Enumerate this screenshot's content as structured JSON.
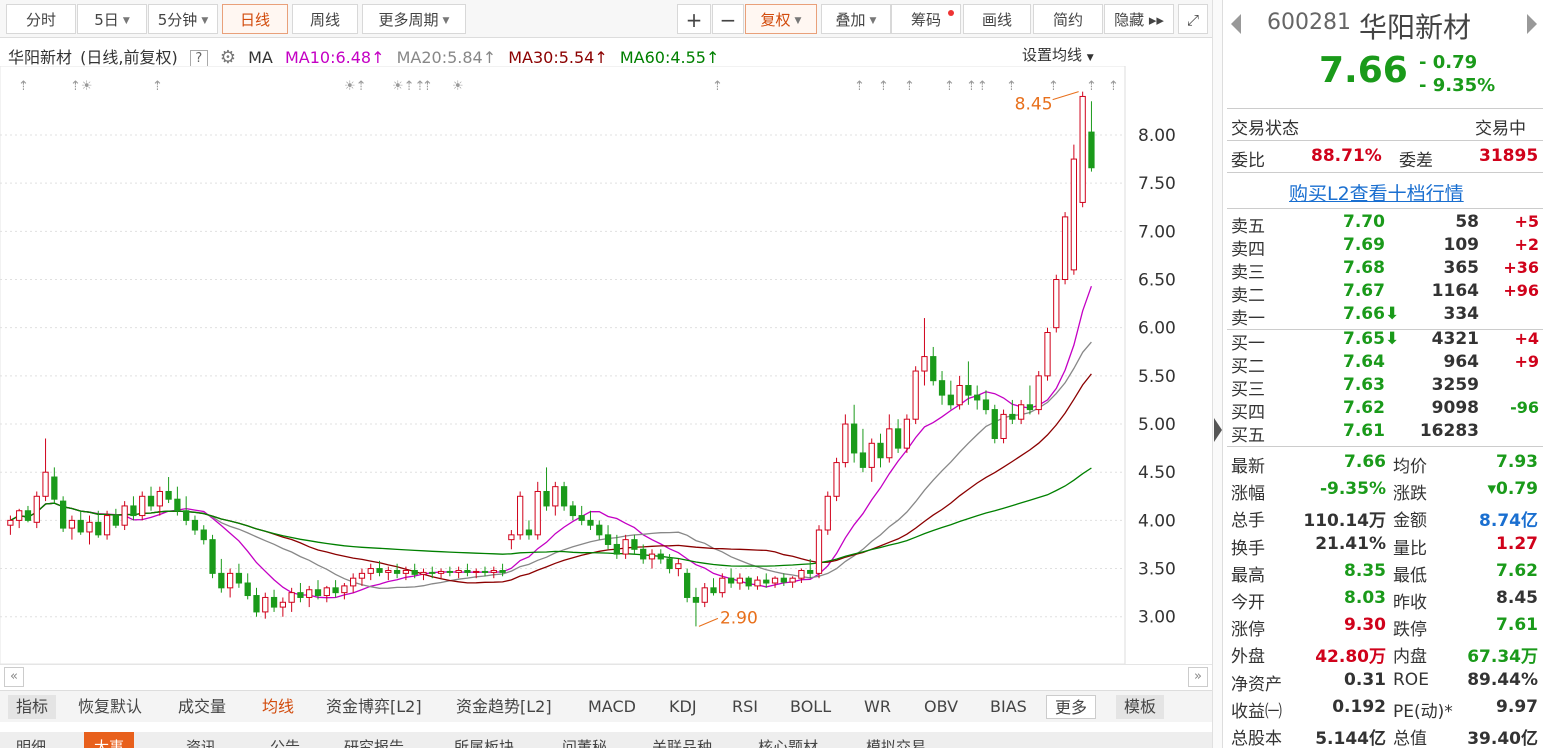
{
  "toolbar": {
    "items": [
      "分时",
      "5日",
      "5分钟",
      "日线",
      "周线",
      "更多周期",
      "+",
      "−",
      "复权",
      "叠加",
      "筹码",
      "画线",
      "简约",
      "隐藏 ▸▸"
    ],
    "active": "日线",
    "fullscreen_icon": "expand-icon"
  },
  "ma_bar": {
    "stock": "华阳新材",
    "mode": "(日线,前复权)",
    "help": "?",
    "ma_label": "MA",
    "ma10": "MA10:6.48",
    "ma20": "MA20:5.84",
    "ma30": "MA30:5.54",
    "ma60": "MA60:4.55",
    "up_arrow": "↑",
    "settings": "设置均线",
    "colors": {
      "ma10": "#c400c4",
      "ma20": "#888888",
      "ma30": "#8b0000",
      "ma60": "#008000"
    }
  },
  "chart_data": {
    "type": "candlestick",
    "y_ticks": [
      "8.00",
      "7.50",
      "7.00",
      "6.50",
      "6.00",
      "5.50",
      "5.00",
      "4.50",
      "4.00",
      "3.50",
      "3.00"
    ],
    "ylim": [
      2.8,
      8.55
    ],
    "high_label": "8.45",
    "low_label": "2.90",
    "candles": [
      [
        3.95,
        4.05,
        3.85,
        4.0
      ],
      [
        4.0,
        4.12,
        3.92,
        4.1
      ],
      [
        4.1,
        4.15,
        3.98,
        4.0
      ],
      [
        3.98,
        4.3,
        3.92,
        4.25
      ],
      [
        4.25,
        4.85,
        4.2,
        4.5
      ],
      [
        4.45,
        4.55,
        4.18,
        4.22
      ],
      [
        4.2,
        4.25,
        3.88,
        3.92
      ],
      [
        3.92,
        4.05,
        3.8,
        4.0
      ],
      [
        4.0,
        4.1,
        3.85,
        3.88
      ],
      [
        3.88,
        4.05,
        3.75,
        3.98
      ],
      [
        3.98,
        4.1,
        3.82,
        3.85
      ],
      [
        3.85,
        4.1,
        3.8,
        4.05
      ],
      [
        4.05,
        4.12,
        3.92,
        3.95
      ],
      [
        3.95,
        4.2,
        3.9,
        4.15
      ],
      [
        4.15,
        4.25,
        4.0,
        4.05
      ],
      [
        4.05,
        4.3,
        4.0,
        4.25
      ],
      [
        4.25,
        4.35,
        4.1,
        4.15
      ],
      [
        4.15,
        4.35,
        4.05,
        4.3
      ],
      [
        4.3,
        4.45,
        4.18,
        4.22
      ],
      [
        4.22,
        4.35,
        4.05,
        4.1
      ],
      [
        4.1,
        4.25,
        3.95,
        4.0
      ],
      [
        4.0,
        4.05,
        3.85,
        3.9
      ],
      [
        3.9,
        3.95,
        3.75,
        3.8
      ],
      [
        3.8,
        3.85,
        3.4,
        3.45
      ],
      [
        3.45,
        3.6,
        3.25,
        3.3
      ],
      [
        3.3,
        3.5,
        3.2,
        3.45
      ],
      [
        3.45,
        3.55,
        3.3,
        3.35
      ],
      [
        3.35,
        3.45,
        3.18,
        3.22
      ],
      [
        3.22,
        3.3,
        3.0,
        3.05
      ],
      [
        3.05,
        3.25,
        2.98,
        3.2
      ],
      [
        3.2,
        3.28,
        3.05,
        3.1
      ],
      [
        3.1,
        3.2,
        3.0,
        3.15
      ],
      [
        3.15,
        3.3,
        3.05,
        3.25
      ],
      [
        3.25,
        3.35,
        3.15,
        3.2
      ],
      [
        3.2,
        3.32,
        3.1,
        3.28
      ],
      [
        3.28,
        3.38,
        3.18,
        3.22
      ],
      [
        3.22,
        3.32,
        3.15,
        3.3
      ],
      [
        3.3,
        3.38,
        3.2,
        3.25
      ],
      [
        3.25,
        3.35,
        3.18,
        3.32
      ],
      [
        3.32,
        3.45,
        3.25,
        3.4
      ],
      [
        3.4,
        3.5,
        3.32,
        3.45
      ],
      [
        3.45,
        3.55,
        3.38,
        3.5
      ],
      [
        3.5,
        3.58,
        3.42,
        3.46
      ],
      [
        3.46,
        3.52,
        3.38,
        3.48
      ],
      [
        3.48,
        3.55,
        3.4,
        3.45
      ],
      [
        3.45,
        3.52,
        3.38,
        3.48
      ],
      [
        3.48,
        3.55,
        3.4,
        3.44
      ],
      [
        3.44,
        3.5,
        3.38,
        3.46
      ],
      [
        3.46,
        3.52,
        3.4,
        3.45
      ],
      [
        3.45,
        3.5,
        3.4,
        3.47
      ],
      [
        3.47,
        3.52,
        3.42,
        3.46
      ],
      [
        3.46,
        3.52,
        3.4,
        3.48
      ],
      [
        3.48,
        3.55,
        3.42,
        3.46
      ],
      [
        3.46,
        3.5,
        3.4,
        3.47
      ],
      [
        3.47,
        3.52,
        3.42,
        3.46
      ],
      [
        3.46,
        3.52,
        3.4,
        3.48
      ],
      [
        3.48,
        3.55,
        3.42,
        3.46
      ],
      [
        3.8,
        3.9,
        3.7,
        3.85
      ],
      [
        3.85,
        4.3,
        3.8,
        4.25
      ],
      [
        3.9,
        4.0,
        3.8,
        3.85
      ],
      [
        3.85,
        4.4,
        3.8,
        4.3
      ],
      [
        4.3,
        4.55,
        4.1,
        4.15
      ],
      [
        4.15,
        4.4,
        4.05,
        4.35
      ],
      [
        4.35,
        4.4,
        4.1,
        4.15
      ],
      [
        4.15,
        4.2,
        4.0,
        4.05
      ],
      [
        4.05,
        4.15,
        3.95,
        4.0
      ],
      [
        4.0,
        4.1,
        3.9,
        3.95
      ],
      [
        3.95,
        4.0,
        3.8,
        3.85
      ],
      [
        3.85,
        3.95,
        3.7,
        3.75
      ],
      [
        3.75,
        3.85,
        3.6,
        3.65
      ],
      [
        3.65,
        3.85,
        3.6,
        3.8
      ],
      [
        3.8,
        3.85,
        3.65,
        3.7
      ],
      [
        3.7,
        3.75,
        3.55,
        3.6
      ],
      [
        3.6,
        3.7,
        3.5,
        3.65
      ],
      [
        3.65,
        3.7,
        3.55,
        3.6
      ],
      [
        3.6,
        3.65,
        3.45,
        3.5
      ],
      [
        3.5,
        3.6,
        3.42,
        3.55
      ],
      [
        3.45,
        3.5,
        3.15,
        3.2
      ],
      [
        3.2,
        3.3,
        2.9,
        3.15
      ],
      [
        3.15,
        3.35,
        3.1,
        3.3
      ],
      [
        3.3,
        3.4,
        3.22,
        3.25
      ],
      [
        3.25,
        3.45,
        3.2,
        3.4
      ],
      [
        3.4,
        3.5,
        3.3,
        3.35
      ],
      [
        3.35,
        3.45,
        3.28,
        3.4
      ],
      [
        3.4,
        3.42,
        3.28,
        3.32
      ],
      [
        3.32,
        3.42,
        3.28,
        3.38
      ],
      [
        3.38,
        3.45,
        3.3,
        3.35
      ],
      [
        3.35,
        3.42,
        3.3,
        3.4
      ],
      [
        3.4,
        3.45,
        3.32,
        3.36
      ],
      [
        3.36,
        3.42,
        3.3,
        3.4
      ],
      [
        3.4,
        3.5,
        3.35,
        3.48
      ],
      [
        3.48,
        3.6,
        3.4,
        3.45
      ],
      [
        3.45,
        3.95,
        3.4,
        3.9
      ],
      [
        3.9,
        4.3,
        3.85,
        4.25
      ],
      [
        4.25,
        4.65,
        4.2,
        4.6
      ],
      [
        4.6,
        5.1,
        4.55,
        5.0
      ],
      [
        5.0,
        5.2,
        4.6,
        4.7
      ],
      [
        4.7,
        4.95,
        4.5,
        4.55
      ],
      [
        4.55,
        4.85,
        4.4,
        4.8
      ],
      [
        4.8,
        4.9,
        4.55,
        4.65
      ],
      [
        4.65,
        5.1,
        4.6,
        4.95
      ],
      [
        4.95,
        5.05,
        4.7,
        4.75
      ],
      [
        4.75,
        5.1,
        4.7,
        5.05
      ],
      [
        5.05,
        5.6,
        5.0,
        5.55
      ],
      [
        5.55,
        6.1,
        5.4,
        5.7
      ],
      [
        5.7,
        5.8,
        5.4,
        5.45
      ],
      [
        5.45,
        5.55,
        5.2,
        5.3
      ],
      [
        5.3,
        5.45,
        5.15,
        5.2
      ],
      [
        5.2,
        5.5,
        5.15,
        5.4
      ],
      [
        5.4,
        5.65,
        5.2,
        5.3
      ],
      [
        5.3,
        5.4,
        5.15,
        5.25
      ],
      [
        5.25,
        5.35,
        5.1,
        5.15
      ],
      [
        5.15,
        5.2,
        4.8,
        4.85
      ],
      [
        4.85,
        5.15,
        4.8,
        5.1
      ],
      [
        5.1,
        5.25,
        5.0,
        5.05
      ],
      [
        5.05,
        5.25,
        5.0,
        5.2
      ],
      [
        5.2,
        5.4,
        5.1,
        5.15
      ],
      [
        5.15,
        5.55,
        5.1,
        5.5
      ],
      [
        5.5,
        6.0,
        5.45,
        5.95
      ],
      [
        6.0,
        6.55,
        5.95,
        6.5
      ],
      [
        6.5,
        7.2,
        6.45,
        7.15
      ],
      [
        6.6,
        7.9,
        6.55,
        7.75
      ],
      [
        7.3,
        8.45,
        7.25,
        8.4
      ],
      [
        8.03,
        8.35,
        7.62,
        7.66
      ]
    ],
    "ma_series": [
      {
        "name": "MA10",
        "color": "#c400c4"
      },
      {
        "name": "MA20",
        "color": "#888888"
      },
      {
        "name": "MA30",
        "color": "#8b0000"
      },
      {
        "name": "MA60",
        "color": "#008000"
      }
    ],
    "event_markers": [
      "⇡",
      "⇡☀",
      "⇡",
      "☀⇡",
      "☀⇡⇡",
      "⇡",
      "☀",
      "⇡",
      "⇡",
      "⇡",
      "⇡",
      "⇡",
      "⇡⇡",
      "⇡",
      "⇡",
      "⇡",
      "⇡"
    ]
  },
  "bottom_tabs": [
    "指标",
    "恢复默认",
    "成交量",
    "均线",
    "资金博弈[L2]",
    "资金趋势[L2]",
    "MACD",
    "KDJ",
    "RSI",
    "BOLL",
    "WR",
    "OBV",
    "BIAS",
    "更多",
    "模板"
  ],
  "bottom_active": "均线",
  "lower_tabs": [
    "明细",
    "大事",
    "资讯",
    "公告",
    "研究报告",
    "所属板块",
    "问董秘",
    "关联品种",
    "核心题材",
    "模拟交易"
  ],
  "lower_active": "大事",
  "quote": {
    "code": "600281",
    "name": "华阳新材",
    "price": "7.66",
    "change": "- 0.79",
    "change_pct": "- 9.35%",
    "status_label": "交易状态",
    "status_value": "交易中",
    "weibi_label": "委比",
    "weibi": "88.71%",
    "weicha_label": "委差",
    "weicha": "31895",
    "l2_link": "购买L2查看十档行情",
    "asks": [
      {
        "label": "卖五",
        "price": "7.70",
        "vol": "58",
        "chg": "+5"
      },
      {
        "label": "卖四",
        "price": "7.69",
        "vol": "109",
        "chg": "+2"
      },
      {
        "label": "卖三",
        "price": "7.68",
        "vol": "365",
        "chg": "+36"
      },
      {
        "label": "卖二",
        "price": "7.67",
        "vol": "1164",
        "chg": "+96"
      },
      {
        "label": "卖一",
        "price": "7.66⬇",
        "vol": "334",
        "chg": ""
      }
    ],
    "bids": [
      {
        "label": "买一",
        "price": "7.65⬇",
        "vol": "4321",
        "chg": "+4"
      },
      {
        "label": "买二",
        "price": "7.64",
        "vol": "964",
        "chg": "+9"
      },
      {
        "label": "买三",
        "price": "7.63",
        "vol": "3259",
        "chg": ""
      },
      {
        "label": "买四",
        "price": "7.62",
        "vol": "9098",
        "chg": "-96"
      },
      {
        "label": "买五",
        "price": "7.61",
        "vol": "16283",
        "chg": ""
      }
    ],
    "stats": [
      [
        {
          "k": "最新",
          "v": "7.66",
          "c": "green"
        },
        {
          "k": "均价",
          "v": "7.93",
          "c": "green"
        }
      ],
      [
        {
          "k": "涨幅",
          "v": "-9.35%",
          "c": "green"
        },
        {
          "k": "涨跌",
          "v": "▾0.79",
          "c": "green"
        }
      ],
      [
        {
          "k": "总手",
          "v": "110.14万",
          "c": "black"
        },
        {
          "k": "金额",
          "v": "8.74亿",
          "c": "blue"
        }
      ],
      [
        {
          "k": "换手",
          "v": "21.41%",
          "c": "black"
        },
        {
          "k": "量比",
          "v": "1.27",
          "c": "red"
        }
      ],
      [
        {
          "k": "最高",
          "v": "8.35",
          "c": "green"
        },
        {
          "k": "最低",
          "v": "7.62",
          "c": "green"
        }
      ],
      [
        {
          "k": "今开",
          "v": "8.03",
          "c": "green"
        },
        {
          "k": "昨收",
          "v": "8.45",
          "c": "black"
        }
      ],
      [
        {
          "k": "涨停",
          "v": "9.30",
          "c": "red"
        },
        {
          "k": "跌停",
          "v": "7.61",
          "c": "green"
        }
      ],
      [
        {
          "k": "外盘",
          "v": "42.80万",
          "c": "red"
        },
        {
          "k": "内盘",
          "v": "67.34万",
          "c": "green"
        }
      ],
      [
        {
          "k": "净资产",
          "v": "0.31",
          "c": "black"
        },
        {
          "k": "ROE",
          "v": "89.44%",
          "c": "black"
        }
      ],
      [
        {
          "k": "收益㈠",
          "v": "0.192",
          "c": "black"
        },
        {
          "k": "PE(动)*",
          "v": "9.97",
          "c": "black"
        }
      ],
      [
        {
          "k": "总股本",
          "v": "5.144亿",
          "c": "black"
        },
        {
          "k": "总值",
          "v": "39.40亿",
          "c": "black"
        }
      ]
    ]
  }
}
